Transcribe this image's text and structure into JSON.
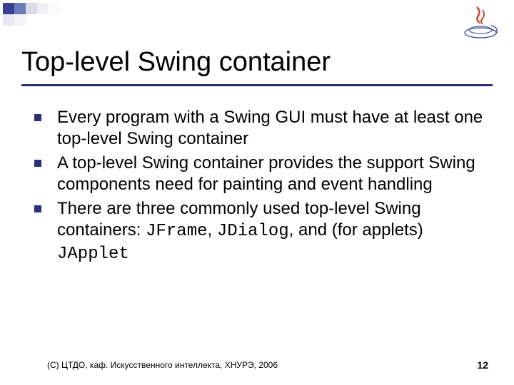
{
  "title": "Top-level Swing container",
  "bullets": [
    {
      "text": "Every program with a Swing GUI must have at least one top-level Swing container"
    },
    {
      "text": "A top-level Swing container provides the support Swing components need for painting and event handling"
    },
    {
      "prefix": "There are three commonly used top-level Swing containers: ",
      "code1": "JFrame",
      "mid1": ", ",
      "code2": "JDialog",
      "mid2": ", and (for applets) ",
      "code3": "JApplet"
    }
  ],
  "footer_left": "(С) ЦТДО, каф. Искусственного интеллекта, ХНУРЭ, 2006",
  "footer_right": "12"
}
